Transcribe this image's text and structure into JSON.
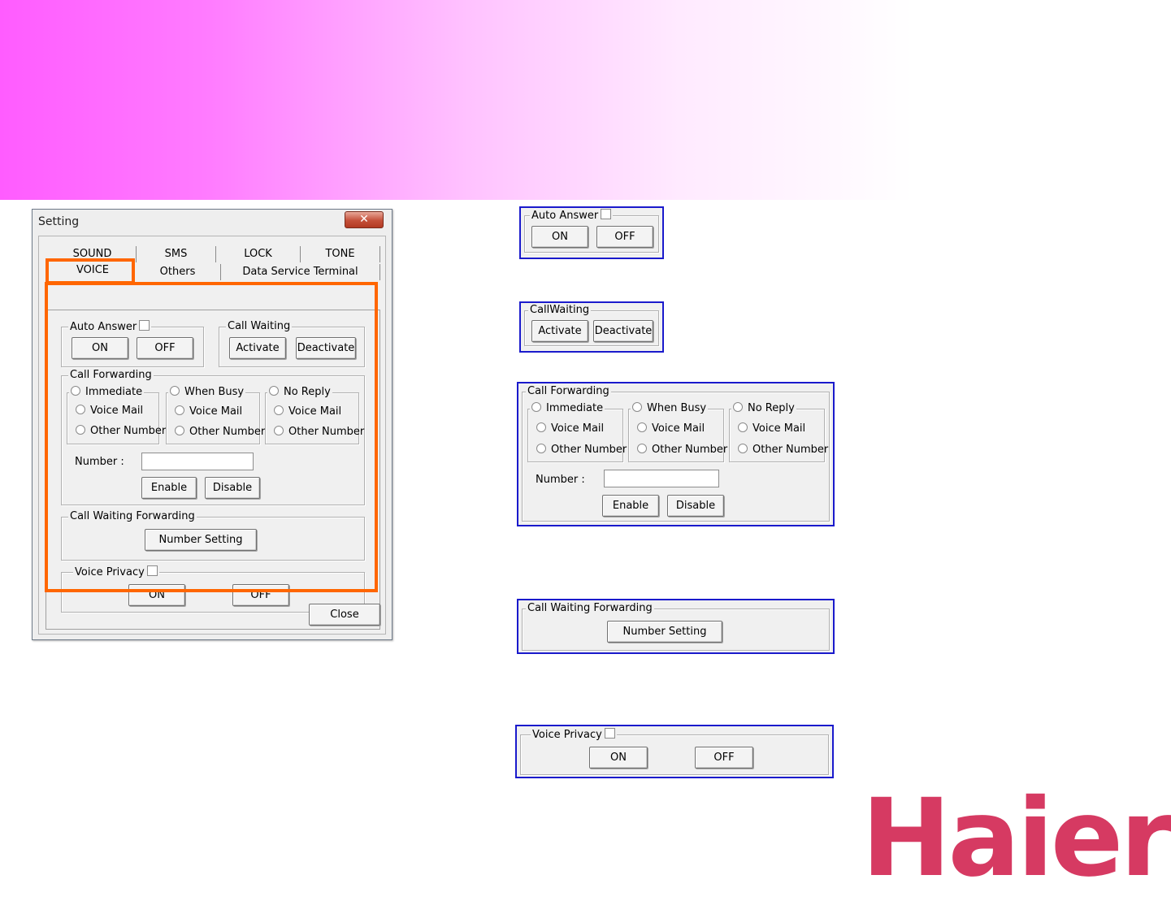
{
  "dialog": {
    "title": "Setting",
    "close_glyph": "✕",
    "tabs_row1": [
      "SOUND",
      "SMS",
      "LOCK",
      "TONE"
    ],
    "tabs_row2": [
      "VOICE",
      "Others",
      "Data Service Terminal"
    ],
    "close_label": "Close"
  },
  "auto_answer": {
    "title": "Auto Answer",
    "on": "ON",
    "off": "OFF"
  },
  "call_waiting": {
    "title": "Call Waiting",
    "activate": "Activate",
    "deactivate": "Deactivate"
  },
  "call_waiting_alt": {
    "title": "CallWaiting",
    "activate": "Activate",
    "deactivate": "Deactivate"
  },
  "call_forwarding": {
    "title": "Call Forwarding",
    "immediate": "Immediate",
    "when_busy": "When Busy",
    "no_reply": "No Reply",
    "voice_mail": "Voice Mail",
    "other_number": "Other Number",
    "number_label": "Number :",
    "number_value": "",
    "enable": "Enable",
    "disable": "Disable"
  },
  "cw_forwarding": {
    "title": "Call Waiting  Forwarding",
    "number_setting": "Number Setting"
  },
  "voice_privacy": {
    "title": "Voice Privacy",
    "on": "ON",
    "off": "OFF"
  },
  "brand": {
    "logo_text": "Haier",
    "color": "#d63a62"
  },
  "colors": {
    "highlight": "#ff6600",
    "panel_border": "#1a1acc"
  }
}
